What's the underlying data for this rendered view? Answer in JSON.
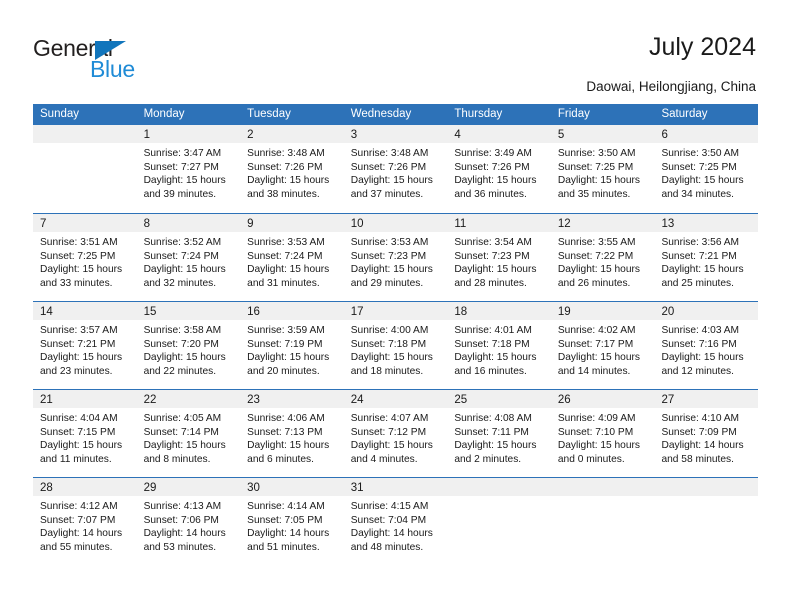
{
  "brand": {
    "name_part1": "General",
    "name_part2": "Blue",
    "triangle_color": "#1175bc",
    "blue_color": "#1f8bd6"
  },
  "header": {
    "title": "July 2024",
    "location": "Daowai, Heilongjiang, China"
  },
  "theme": {
    "header_blue": "#2d72b8",
    "band_gray": "#f0f0f0"
  },
  "calendar": {
    "weekdays": [
      "Sunday",
      "Monday",
      "Tuesday",
      "Wednesday",
      "Thursday",
      "Friday",
      "Saturday"
    ],
    "weeks": [
      [
        {
          "day": ""
        },
        {
          "day": "1",
          "sunrise": "Sunrise: 3:47 AM",
          "sunset": "Sunset: 7:27 PM",
          "daylight1": "Daylight: 15 hours",
          "daylight2": "and 39 minutes."
        },
        {
          "day": "2",
          "sunrise": "Sunrise: 3:48 AM",
          "sunset": "Sunset: 7:26 PM",
          "daylight1": "Daylight: 15 hours",
          "daylight2": "and 38 minutes."
        },
        {
          "day": "3",
          "sunrise": "Sunrise: 3:48 AM",
          "sunset": "Sunset: 7:26 PM",
          "daylight1": "Daylight: 15 hours",
          "daylight2": "and 37 minutes."
        },
        {
          "day": "4",
          "sunrise": "Sunrise: 3:49 AM",
          "sunset": "Sunset: 7:26 PM",
          "daylight1": "Daylight: 15 hours",
          "daylight2": "and 36 minutes."
        },
        {
          "day": "5",
          "sunrise": "Sunrise: 3:50 AM",
          "sunset": "Sunset: 7:25 PM",
          "daylight1": "Daylight: 15 hours",
          "daylight2": "and 35 minutes."
        },
        {
          "day": "6",
          "sunrise": "Sunrise: 3:50 AM",
          "sunset": "Sunset: 7:25 PM",
          "daylight1": "Daylight: 15 hours",
          "daylight2": "and 34 minutes."
        }
      ],
      [
        {
          "day": "7",
          "sunrise": "Sunrise: 3:51 AM",
          "sunset": "Sunset: 7:25 PM",
          "daylight1": "Daylight: 15 hours",
          "daylight2": "and 33 minutes."
        },
        {
          "day": "8",
          "sunrise": "Sunrise: 3:52 AM",
          "sunset": "Sunset: 7:24 PM",
          "daylight1": "Daylight: 15 hours",
          "daylight2": "and 32 minutes."
        },
        {
          "day": "9",
          "sunrise": "Sunrise: 3:53 AM",
          "sunset": "Sunset: 7:24 PM",
          "daylight1": "Daylight: 15 hours",
          "daylight2": "and 31 minutes."
        },
        {
          "day": "10",
          "sunrise": "Sunrise: 3:53 AM",
          "sunset": "Sunset: 7:23 PM",
          "daylight1": "Daylight: 15 hours",
          "daylight2": "and 29 minutes."
        },
        {
          "day": "11",
          "sunrise": "Sunrise: 3:54 AM",
          "sunset": "Sunset: 7:23 PM",
          "daylight1": "Daylight: 15 hours",
          "daylight2": "and 28 minutes."
        },
        {
          "day": "12",
          "sunrise": "Sunrise: 3:55 AM",
          "sunset": "Sunset: 7:22 PM",
          "daylight1": "Daylight: 15 hours",
          "daylight2": "and 26 minutes."
        },
        {
          "day": "13",
          "sunrise": "Sunrise: 3:56 AM",
          "sunset": "Sunset: 7:21 PM",
          "daylight1": "Daylight: 15 hours",
          "daylight2": "and 25 minutes."
        }
      ],
      [
        {
          "day": "14",
          "sunrise": "Sunrise: 3:57 AM",
          "sunset": "Sunset: 7:21 PM",
          "daylight1": "Daylight: 15 hours",
          "daylight2": "and 23 minutes."
        },
        {
          "day": "15",
          "sunrise": "Sunrise: 3:58 AM",
          "sunset": "Sunset: 7:20 PM",
          "daylight1": "Daylight: 15 hours",
          "daylight2": "and 22 minutes."
        },
        {
          "day": "16",
          "sunrise": "Sunrise: 3:59 AM",
          "sunset": "Sunset: 7:19 PM",
          "daylight1": "Daylight: 15 hours",
          "daylight2": "and 20 minutes."
        },
        {
          "day": "17",
          "sunrise": "Sunrise: 4:00 AM",
          "sunset": "Sunset: 7:18 PM",
          "daylight1": "Daylight: 15 hours",
          "daylight2": "and 18 minutes."
        },
        {
          "day": "18",
          "sunrise": "Sunrise: 4:01 AM",
          "sunset": "Sunset: 7:18 PM",
          "daylight1": "Daylight: 15 hours",
          "daylight2": "and 16 minutes."
        },
        {
          "day": "19",
          "sunrise": "Sunrise: 4:02 AM",
          "sunset": "Sunset: 7:17 PM",
          "daylight1": "Daylight: 15 hours",
          "daylight2": "and 14 minutes."
        },
        {
          "day": "20",
          "sunrise": "Sunrise: 4:03 AM",
          "sunset": "Sunset: 7:16 PM",
          "daylight1": "Daylight: 15 hours",
          "daylight2": "and 12 minutes."
        }
      ],
      [
        {
          "day": "21",
          "sunrise": "Sunrise: 4:04 AM",
          "sunset": "Sunset: 7:15 PM",
          "daylight1": "Daylight: 15 hours",
          "daylight2": "and 11 minutes."
        },
        {
          "day": "22",
          "sunrise": "Sunrise: 4:05 AM",
          "sunset": "Sunset: 7:14 PM",
          "daylight1": "Daylight: 15 hours",
          "daylight2": "and 8 minutes."
        },
        {
          "day": "23",
          "sunrise": "Sunrise: 4:06 AM",
          "sunset": "Sunset: 7:13 PM",
          "daylight1": "Daylight: 15 hours",
          "daylight2": "and 6 minutes."
        },
        {
          "day": "24",
          "sunrise": "Sunrise: 4:07 AM",
          "sunset": "Sunset: 7:12 PM",
          "daylight1": "Daylight: 15 hours",
          "daylight2": "and 4 minutes."
        },
        {
          "day": "25",
          "sunrise": "Sunrise: 4:08 AM",
          "sunset": "Sunset: 7:11 PM",
          "daylight1": "Daylight: 15 hours",
          "daylight2": "and 2 minutes."
        },
        {
          "day": "26",
          "sunrise": "Sunrise: 4:09 AM",
          "sunset": "Sunset: 7:10 PM",
          "daylight1": "Daylight: 15 hours",
          "daylight2": "and 0 minutes."
        },
        {
          "day": "27",
          "sunrise": "Sunrise: 4:10 AM",
          "sunset": "Sunset: 7:09 PM",
          "daylight1": "Daylight: 14 hours",
          "daylight2": "and 58 minutes."
        }
      ],
      [
        {
          "day": "28",
          "sunrise": "Sunrise: 4:12 AM",
          "sunset": "Sunset: 7:07 PM",
          "daylight1": "Daylight: 14 hours",
          "daylight2": "and 55 minutes."
        },
        {
          "day": "29",
          "sunrise": "Sunrise: 4:13 AM",
          "sunset": "Sunset: 7:06 PM",
          "daylight1": "Daylight: 14 hours",
          "daylight2": "and 53 minutes."
        },
        {
          "day": "30",
          "sunrise": "Sunrise: 4:14 AM",
          "sunset": "Sunset: 7:05 PM",
          "daylight1": "Daylight: 14 hours",
          "daylight2": "and 51 minutes."
        },
        {
          "day": "31",
          "sunrise": "Sunrise: 4:15 AM",
          "sunset": "Sunset: 7:04 PM",
          "daylight1": "Daylight: 14 hours",
          "daylight2": "and 48 minutes."
        },
        {
          "day": ""
        },
        {
          "day": ""
        },
        {
          "day": ""
        }
      ]
    ]
  }
}
